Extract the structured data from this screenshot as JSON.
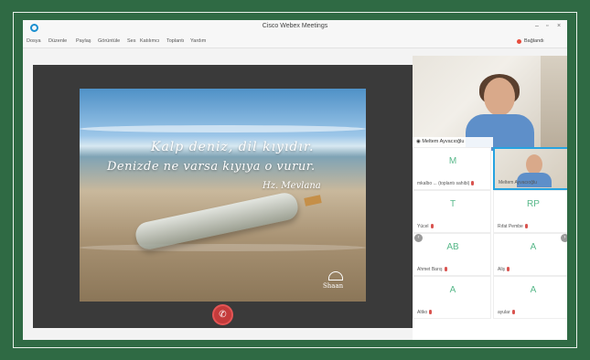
{
  "window": {
    "title": "Cisco Webex Meetings",
    "connection_label": "Bağlandı",
    "minimize": "–",
    "maximize": "▫",
    "close": "×"
  },
  "menu": {
    "items": [
      "Dosya",
      "Düzenle",
      "Paylaş",
      "Görüntüle",
      "Ses",
      "Katılımcı",
      "Toplantı",
      "Yardım"
    ]
  },
  "slide": {
    "quote_line1": "Kalp deniz, dil kıyıdır.",
    "quote_line2": "Denizde ne varsa kıyıya o vurur.",
    "author": "Hz. Mevlana",
    "logo_text": "Shaan"
  },
  "controls": {
    "end_call_icon": "✆"
  },
  "active_speaker": {
    "name": "Meltem Ayvacıoğlu"
  },
  "participants": [
    {
      "initials": "M",
      "name": "mkalbo ... (toplantı sahibi)"
    },
    {
      "initials": "",
      "name": "Meltem Ayvacıoğlu"
    },
    {
      "initials": "T",
      "name": "Yücel"
    },
    {
      "initials": "RP",
      "name": "Rıfat Pembe"
    },
    {
      "initials": "AB",
      "name": "Ahmet Barış"
    },
    {
      "initials": "A",
      "name": "Aliş"
    },
    {
      "initials": "A",
      "name": "Altko"
    },
    {
      "initials": "A",
      "name": "ayular"
    }
  ],
  "colors": {
    "frame_green": "#2f6a44",
    "accent_blue": "#27a3e0",
    "end_call_red": "#c43b3b",
    "initials_green": "#58b88a"
  }
}
